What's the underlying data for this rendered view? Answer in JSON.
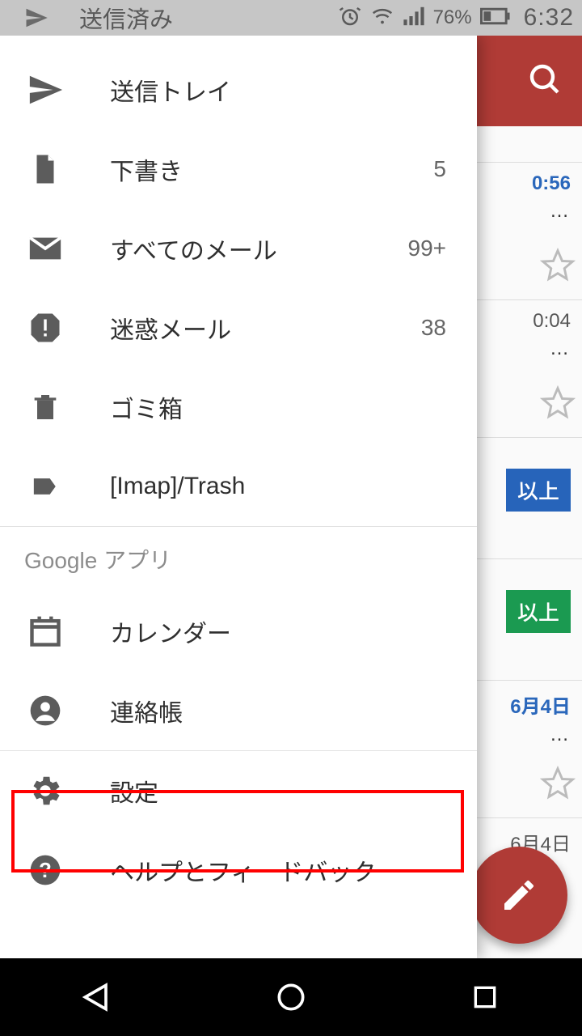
{
  "status": {
    "title": "送信済み",
    "battery_percent": "76%",
    "time": "6:32"
  },
  "drawer": {
    "folders": [
      {
        "key": "sent",
        "label": "送信トレイ",
        "count": ""
      },
      {
        "key": "drafts",
        "label": "下書き",
        "count": "5"
      },
      {
        "key": "allmail",
        "label": "すべてのメール",
        "count": "99+"
      },
      {
        "key": "spam",
        "label": "迷惑メール",
        "count": "38"
      },
      {
        "key": "trash",
        "label": "ゴミ箱",
        "count": ""
      },
      {
        "key": "imap",
        "label": "[Imap]/Trash",
        "count": ""
      }
    ],
    "google_apps_header": "Google アプリ",
    "apps": [
      {
        "key": "calendar",
        "label": "カレンダー"
      },
      {
        "key": "contacts",
        "label": "連絡帳"
      }
    ],
    "footer": [
      {
        "key": "settings",
        "label": "設定"
      },
      {
        "key": "help",
        "label": "ヘルプとフィードバック"
      }
    ]
  },
  "bg": {
    "rows": [
      {
        "time": "0:56",
        "time_style": "blue"
      },
      {
        "time": "0:04",
        "time_style": "black"
      },
      {
        "badge": "以上",
        "badge_style": "blue"
      },
      {
        "badge": "以上",
        "badge_style": "green"
      },
      {
        "time": "6月4日",
        "time_style": "blue"
      },
      {
        "time": "6月4日",
        "time_style": "black"
      }
    ]
  }
}
